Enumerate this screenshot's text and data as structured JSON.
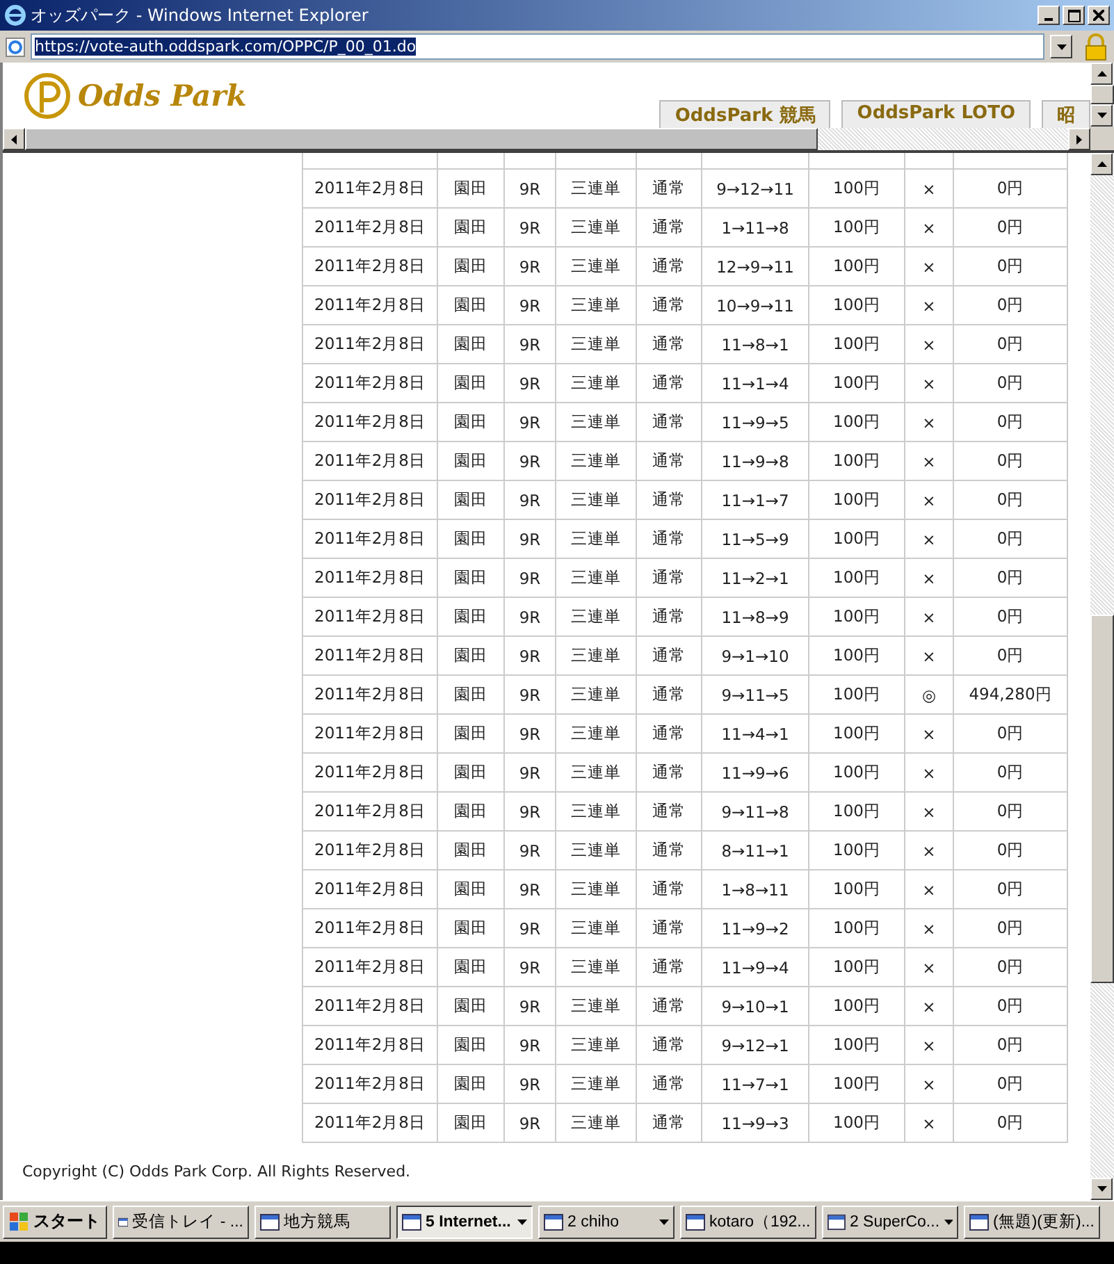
{
  "window": {
    "title": "オッズパーク - Windows Internet Explorer"
  },
  "address_bar": {
    "url": "https://vote-auth.oddspark.com/OPPC/P_00_01.do"
  },
  "header": {
    "logo": "Odds Park",
    "tabs": [
      {
        "label": "OddsPark 競馬"
      },
      {
        "label": "OddsPark LOTO"
      },
      {
        "label": "昭"
      }
    ]
  },
  "table": {
    "rows": [
      {
        "cells": [
          "2011年2月8日",
          "園田",
          "9R",
          "三連単",
          "通常",
          "9→12→11",
          "100円",
          "×",
          "0円"
        ]
      },
      {
        "cells": [
          "2011年2月8日",
          "園田",
          "9R",
          "三連単",
          "通常",
          "1→11→8",
          "100円",
          "×",
          "0円"
        ]
      },
      {
        "cells": [
          "2011年2月8日",
          "園田",
          "9R",
          "三連単",
          "通常",
          "12→9→11",
          "100円",
          "×",
          "0円"
        ]
      },
      {
        "cells": [
          "2011年2月8日",
          "園田",
          "9R",
          "三連単",
          "通常",
          "10→9→11",
          "100円",
          "×",
          "0円"
        ]
      },
      {
        "cells": [
          "2011年2月8日",
          "園田",
          "9R",
          "三連単",
          "通常",
          "11→8→1",
          "100円",
          "×",
          "0円"
        ]
      },
      {
        "cells": [
          "2011年2月8日",
          "園田",
          "9R",
          "三連単",
          "通常",
          "11→1→4",
          "100円",
          "×",
          "0円"
        ]
      },
      {
        "cells": [
          "2011年2月8日",
          "園田",
          "9R",
          "三連単",
          "通常",
          "11→9→5",
          "100円",
          "×",
          "0円"
        ]
      },
      {
        "cells": [
          "2011年2月8日",
          "園田",
          "9R",
          "三連単",
          "通常",
          "11→9→8",
          "100円",
          "×",
          "0円"
        ]
      },
      {
        "cells": [
          "2011年2月8日",
          "園田",
          "9R",
          "三連単",
          "通常",
          "11→1→7",
          "100円",
          "×",
          "0円"
        ]
      },
      {
        "cells": [
          "2011年2月8日",
          "園田",
          "9R",
          "三連単",
          "通常",
          "11→5→9",
          "100円",
          "×",
          "0円"
        ]
      },
      {
        "cells": [
          "2011年2月8日",
          "園田",
          "9R",
          "三連単",
          "通常",
          "11→2→1",
          "100円",
          "×",
          "0円"
        ]
      },
      {
        "cells": [
          "2011年2月8日",
          "園田",
          "9R",
          "三連単",
          "通常",
          "11→8→9",
          "100円",
          "×",
          "0円"
        ]
      },
      {
        "cells": [
          "2011年2月8日",
          "園田",
          "9R",
          "三連単",
          "通常",
          "9→1→10",
          "100円",
          "×",
          "0円"
        ]
      },
      {
        "cells": [
          "2011年2月8日",
          "園田",
          "9R",
          "三連単",
          "通常",
          "9→11→5",
          "100円",
          "◎",
          "494,280円"
        ]
      },
      {
        "cells": [
          "2011年2月8日",
          "園田",
          "9R",
          "三連単",
          "通常",
          "11→4→1",
          "100円",
          "×",
          "0円"
        ]
      },
      {
        "cells": [
          "2011年2月8日",
          "園田",
          "9R",
          "三連単",
          "通常",
          "11→9→6",
          "100円",
          "×",
          "0円"
        ]
      },
      {
        "cells": [
          "2011年2月8日",
          "園田",
          "9R",
          "三連単",
          "通常",
          "9→11→8",
          "100円",
          "×",
          "0円"
        ]
      },
      {
        "cells": [
          "2011年2月8日",
          "園田",
          "9R",
          "三連単",
          "通常",
          "8→11→1",
          "100円",
          "×",
          "0円"
        ]
      },
      {
        "cells": [
          "2011年2月8日",
          "園田",
          "9R",
          "三連単",
          "通常",
          "1→8→11",
          "100円",
          "×",
          "0円"
        ]
      },
      {
        "cells": [
          "2011年2月8日",
          "園田",
          "9R",
          "三連単",
          "通常",
          "11→9→2",
          "100円",
          "×",
          "0円"
        ]
      },
      {
        "cells": [
          "2011年2月8日",
          "園田",
          "9R",
          "三連単",
          "通常",
          "11→9→4",
          "100円",
          "×",
          "0円"
        ]
      },
      {
        "cells": [
          "2011年2月8日",
          "園田",
          "9R",
          "三連単",
          "通常",
          "9→10→1",
          "100円",
          "×",
          "0円"
        ]
      },
      {
        "cells": [
          "2011年2月8日",
          "園田",
          "9R",
          "三連単",
          "通常",
          "9→12→1",
          "100円",
          "×",
          "0円"
        ]
      },
      {
        "cells": [
          "2011年2月8日",
          "園田",
          "9R",
          "三連単",
          "通常",
          "11→7→1",
          "100円",
          "×",
          "0円"
        ]
      },
      {
        "cells": [
          "2011年2月8日",
          "園田",
          "9R",
          "三連単",
          "通常",
          "11→9→3",
          "100円",
          "×",
          "0円"
        ]
      }
    ]
  },
  "footer": {
    "copyright": "Copyright (C) Odds Park Corp. All Rights Reserved."
  },
  "taskbar": {
    "start": "スタート",
    "items": [
      {
        "label": "受信トレイ - ...",
        "selected": false,
        "grouped": false
      },
      {
        "label": "地方競馬",
        "selected": false,
        "grouped": false
      },
      {
        "label": "5 Internet...",
        "selected": true,
        "grouped": true
      },
      {
        "label": "2 chiho",
        "selected": false,
        "grouped": true
      },
      {
        "label": "kotaro（192...",
        "selected": false,
        "grouped": false
      },
      {
        "label": "2 SuperCo...",
        "selected": false,
        "grouped": true
      },
      {
        "label": "(無題)(更新)...",
        "selected": false,
        "grouped": false
      }
    ]
  }
}
